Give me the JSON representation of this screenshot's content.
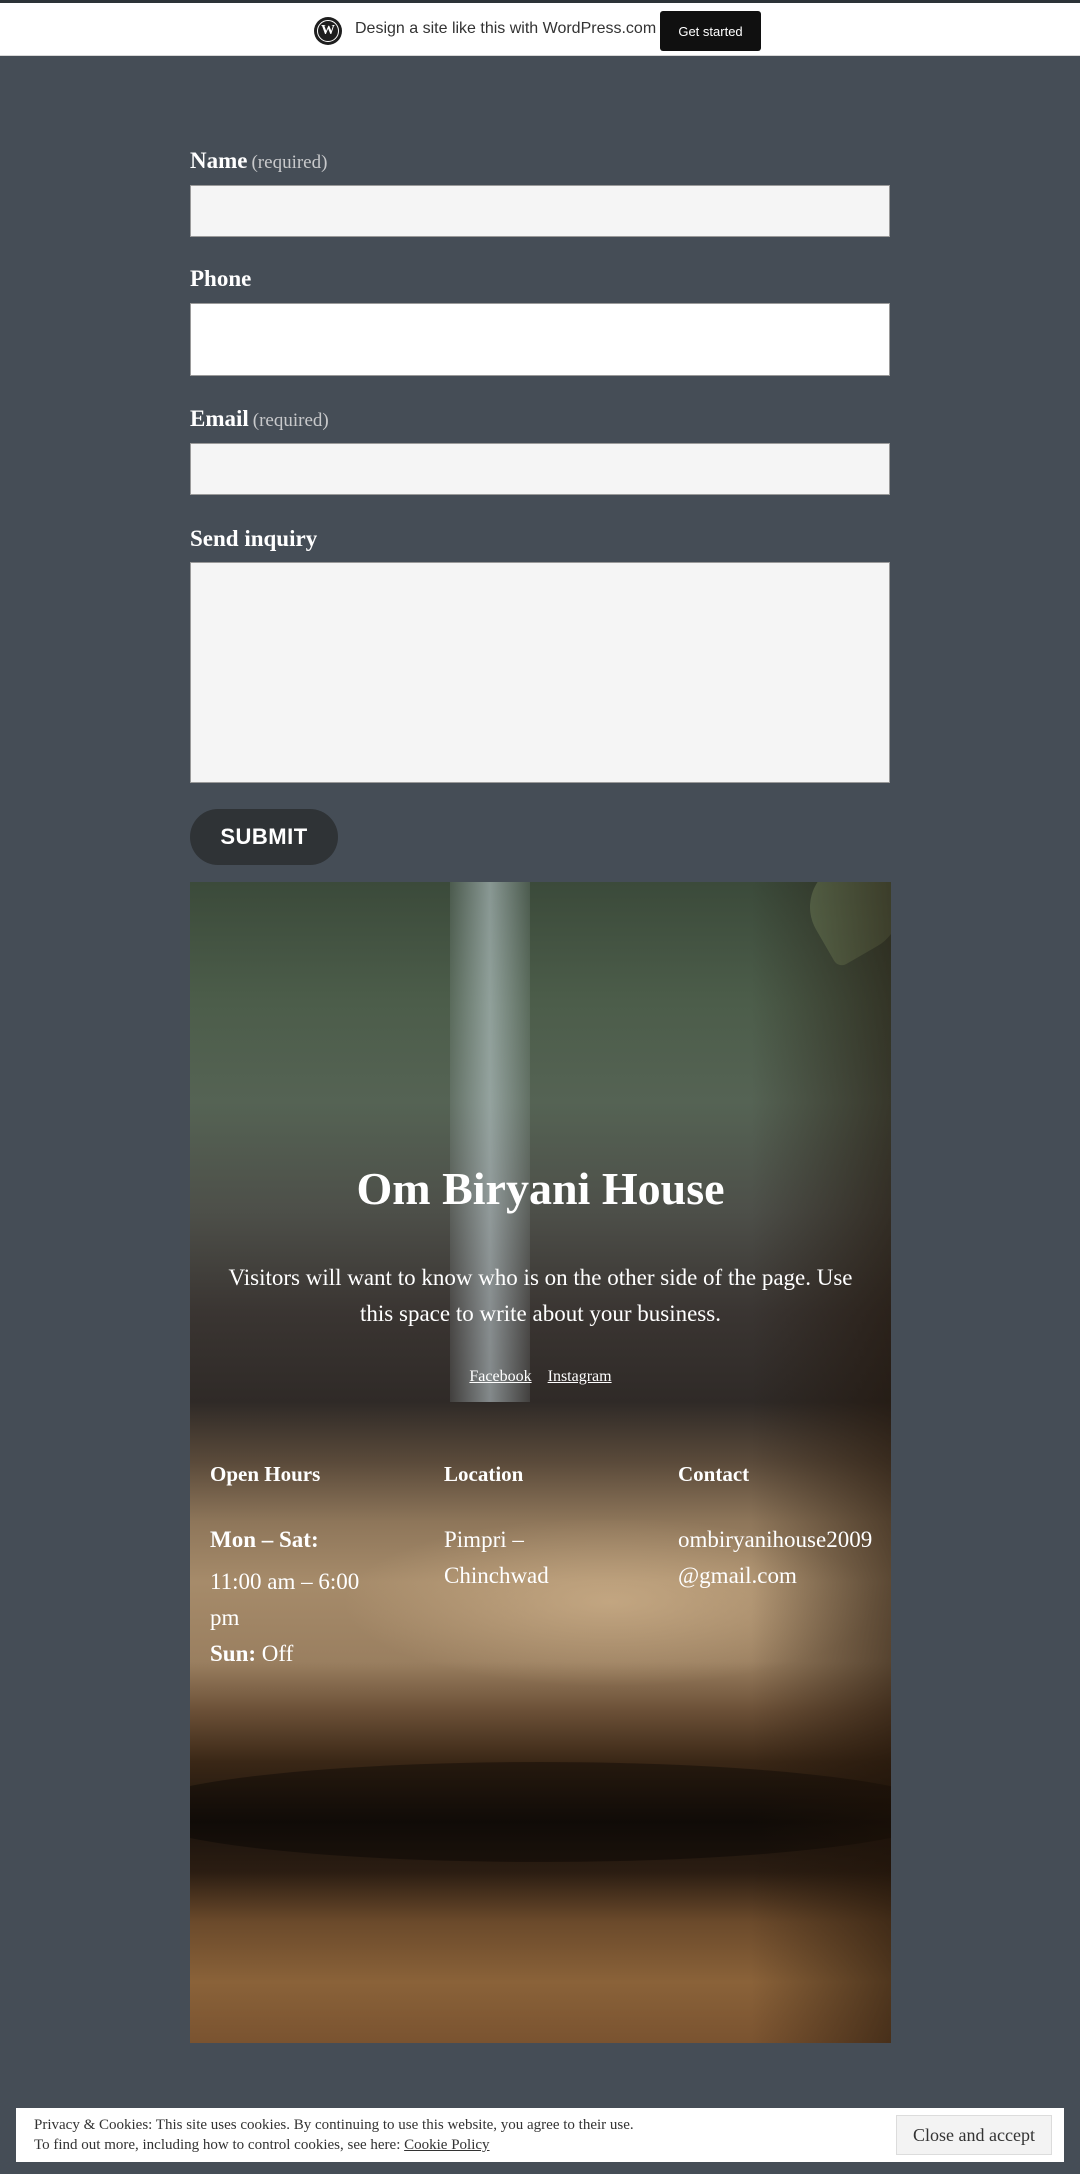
{
  "topbar": {
    "logo_glyph": "W",
    "text": "Design a site like this with WordPress.com",
    "cta_label": "Get started"
  },
  "form": {
    "name_label": "Name",
    "name_required": "(required)",
    "phone_label": "Phone",
    "email_label": "Email",
    "email_required": "(required)",
    "inquiry_label": "Send inquiry",
    "submit_label": "SUBMIT"
  },
  "cover": {
    "title": "Om Biryani House",
    "description": "Visitors will want to know who is on the other side of the page. Use this space to write about your business.",
    "social": [
      "Facebook",
      "Instagram"
    ],
    "columns": {
      "hours": {
        "title": "Open Hours",
        "days1": "Mon – Sat:",
        "time1": "11:00 am – 6:00 pm",
        "days2": "Sun:",
        "time2": "Off"
      },
      "location": {
        "title": "Location",
        "text": "Pimpri – Chinchwad"
      },
      "contact": {
        "title": "Contact",
        "text": "ombiryanihouse2009@gmail.com"
      }
    }
  },
  "cookie": {
    "line1": "Privacy & Cookies: This site uses cookies. By continuing to use this website, you agree to their use.",
    "line2": "To find out more, including how to control cookies, see here:",
    "link": "Cookie Policy",
    "button": "Close and accept"
  }
}
